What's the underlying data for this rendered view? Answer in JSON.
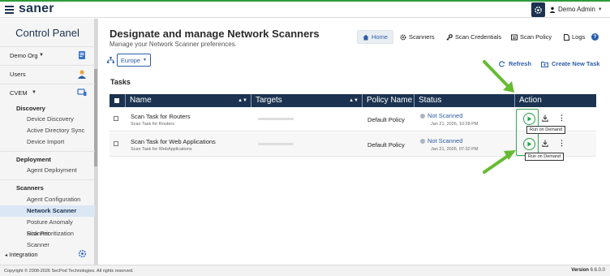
{
  "app": {
    "brand": "saner",
    "user": "Demo Admin"
  },
  "sidebar": {
    "title": "Control Panel",
    "org": "Demo Org",
    "users": "Users",
    "cvem": "CVEM",
    "groups": [
      {
        "heading": "Discovery",
        "items": [
          "Device Discovery",
          "Active Directory Sync",
          "Device Import"
        ]
      },
      {
        "heading": "Deployment",
        "items": [
          "Agent Deployment"
        ]
      },
      {
        "heading": "Scanners",
        "items": [
          "Agent Configuration",
          "Network Scanner",
          "Posture Anomaly Scanner",
          "Risk Prioritization Scanner"
        ]
      }
    ],
    "active_item": "Network Scanner",
    "integration": "Integration"
  },
  "header": {
    "title": "Designate and manage Network Scanners",
    "subtitle": "Manage your Network Scanner preferences.",
    "nav": [
      "Home",
      "Scanners",
      "Scan Credentials",
      "Scan Policy",
      "Logs"
    ],
    "help": "?"
  },
  "toolbar": {
    "region": "Europe",
    "refresh": "Refresh",
    "create": "Create New Task"
  },
  "tasks": {
    "heading": "Tasks",
    "columns": [
      "Name",
      "Targets",
      "Policy Name",
      "Status",
      "Action"
    ],
    "rows": [
      {
        "name": "Scan Task for Routers",
        "subname": "Scan Task for Routers",
        "policy": "Default Policy",
        "status": "Not Scanned",
        "timestamp": "Jan 21, 2026, 10:28 PM",
        "tooltip": "Run on Demand"
      },
      {
        "name": "Scan Task for Web Applications",
        "subname": "Scan Task for WebApplications",
        "policy": "Default Policy",
        "status": "Not Scanned",
        "timestamp": "Jan 21, 2026, 07:32 PM",
        "tooltip": "Run on Demand"
      }
    ]
  },
  "footer": {
    "copyright": "Copyright © 2008-2026 SecPod Technologies. All rights reserved.",
    "version_label": "Version",
    "version": "6.6.0.0"
  },
  "colors": {
    "navy": "#1b3350",
    "link": "#2b5da8",
    "highlight": "#34a853",
    "play": "#22a04a"
  }
}
